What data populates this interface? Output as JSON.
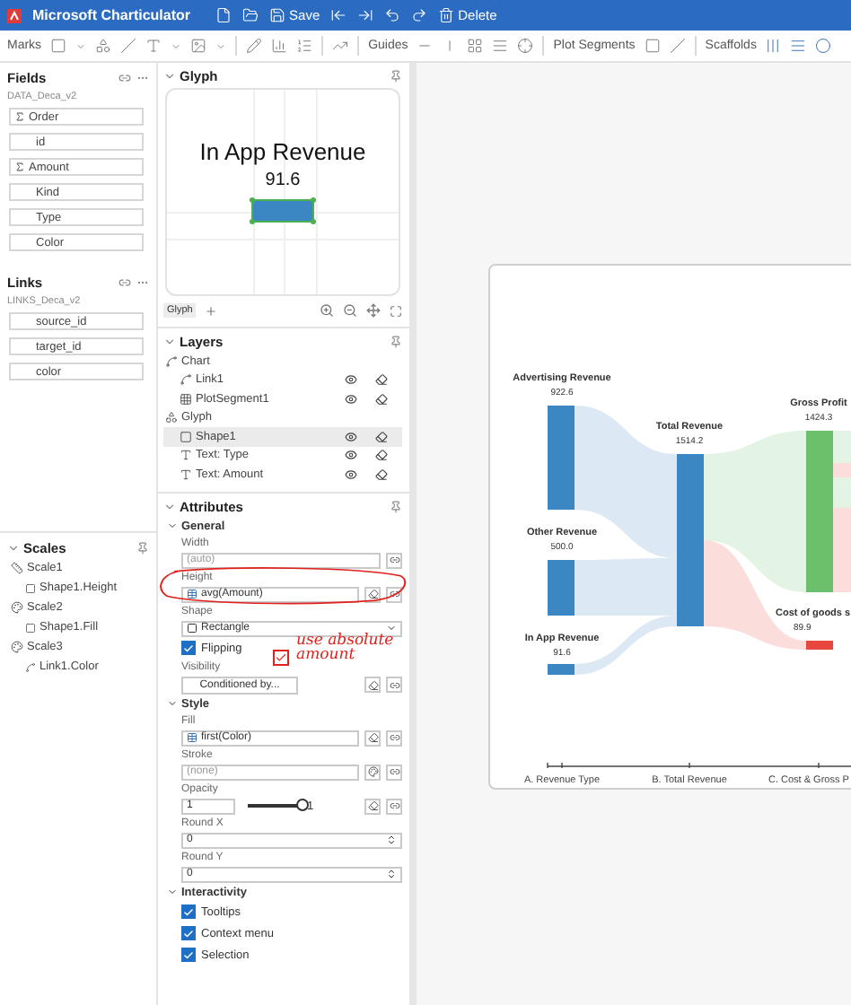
{
  "window": {
    "title": "Microsoft Charticulator"
  },
  "title_actions": [
    {
      "kind": "new"
    },
    {
      "kind": "open"
    },
    {
      "kind": "save",
      "label": "Save"
    },
    {
      "kind": "export-left"
    },
    {
      "kind": "export-right"
    },
    {
      "kind": "undo"
    },
    {
      "kind": "redo"
    },
    {
      "kind": "delete",
      "label": "Delete"
    }
  ],
  "toolbar": [
    {
      "label": "Marks"
    },
    {
      "label": "Guides"
    },
    {
      "label": "Plot Segments"
    },
    {
      "label": "Scaffolds"
    }
  ],
  "fields": {
    "title": "Fields",
    "dataset": "DATA_Deca_v2",
    "items": [
      {
        "name": "Order",
        "numeric": true
      },
      {
        "name": "id",
        "numeric": false
      },
      {
        "name": "Amount",
        "numeric": true
      },
      {
        "name": "Kind",
        "numeric": false
      },
      {
        "name": "Type",
        "numeric": false
      },
      {
        "name": "Color",
        "numeric": false
      }
    ]
  },
  "links": {
    "title": "Links",
    "dataset": "LINKS_Deca_v2",
    "items": [
      {
        "name": "source_id",
        "numeric": false
      },
      {
        "name": "target_id",
        "numeric": false
      },
      {
        "name": "color",
        "numeric": false
      }
    ]
  },
  "scales": {
    "title": "Scales",
    "items": [
      {
        "name": "Scale1",
        "kind": "number",
        "children": [
          {
            "name": "Shape1.Height",
            "kind": "attribute"
          }
        ]
      },
      {
        "name": "Scale2",
        "kind": "color",
        "children": [
          {
            "name": "Shape1.Fill",
            "kind": "attribute"
          }
        ]
      },
      {
        "name": "Scale3",
        "kind": "color",
        "children": [
          {
            "name": "Link1.Color",
            "kind": "link"
          }
        ]
      }
    ]
  },
  "glyph": {
    "title": "Glyph",
    "preview_title": "In App Revenue",
    "preview_value": "91.6",
    "tab": "Glyph"
  },
  "layers": {
    "title": "Layers",
    "items": [
      {
        "name": "Chart",
        "kind": "chart",
        "selected": false,
        "children": [
          {
            "name": "Link1",
            "kind": "link",
            "selected": false
          },
          {
            "name": "PlotSegment1",
            "kind": "grid",
            "selected": false
          }
        ]
      },
      {
        "name": "Glyph",
        "kind": "glyph",
        "selected": false,
        "children": [
          {
            "name": "Shape1",
            "kind": "shape",
            "selected": true
          },
          {
            "name": "Text: Type",
            "kind": "text",
            "selected": false
          },
          {
            "name": "Text: Amount",
            "kind": "text",
            "selected": false
          }
        ]
      }
    ]
  },
  "attributes": {
    "title": "Attributes",
    "sections": [
      {
        "title": "General",
        "rows": [
          {
            "kind": "field",
            "label": "Width",
            "placeholder": "(auto)"
          },
          {
            "kind": "bound",
            "label": "Height",
            "value": "avg(Amount)"
          },
          {
            "kind": "select",
            "label": "Shape",
            "value": "Rectangle"
          },
          {
            "kind": "checkbox",
            "label": "Flipping",
            "checked": true
          },
          {
            "kind": "button",
            "label": "Visibility",
            "value": "Conditioned by..."
          }
        ]
      },
      {
        "title": "Style",
        "rows": [
          {
            "kind": "bound",
            "label": "Fill",
            "value": "first(Color)"
          },
          {
            "kind": "color",
            "label": "Stroke",
            "placeholder": "(none)"
          },
          {
            "kind": "slider",
            "label": "Opacity",
            "value": "1",
            "level": 1,
            "reading": "1"
          },
          {
            "kind": "number",
            "label": "Round X",
            "value": "0"
          },
          {
            "kind": "number",
            "label": "Round Y",
            "value": "0"
          }
        ]
      },
      {
        "title": "Interactivity",
        "rows": [
          {
            "kind": "checkbox",
            "label": "Tooltips",
            "checked": true
          },
          {
            "kind": "checkbox",
            "label": "Context menu",
            "checked": true
          },
          {
            "kind": "checkbox",
            "label": "Selection",
            "checked": true
          }
        ]
      }
    ]
  },
  "annotation": {
    "text": "use absolute amount",
    "checked": true
  },
  "chart": {
    "nodes": [
      {
        "label": "Advertising Revenue",
        "value": "922.6",
        "color": "#3b87c4"
      },
      {
        "label": "Other Revenue",
        "value": "500.0",
        "color": "#3b87c4"
      },
      {
        "label": "In App Revenue",
        "value": "91.6",
        "color": "#3b87c4"
      },
      {
        "label": "Total Revenue",
        "value": "1514.2",
        "color": "#3b87c4"
      },
      {
        "label": "Gross Profit",
        "value": "1424.3",
        "color": "#6cc06b"
      },
      {
        "label": "Cost of goods s",
        "value": "89.9",
        "color": "#e8473f"
      }
    ],
    "axis": [
      {
        "label": "A. Revenue Type"
      },
      {
        "label": "B. Total Revenue"
      },
      {
        "label": "C. Cost & Gross P"
      }
    ]
  }
}
